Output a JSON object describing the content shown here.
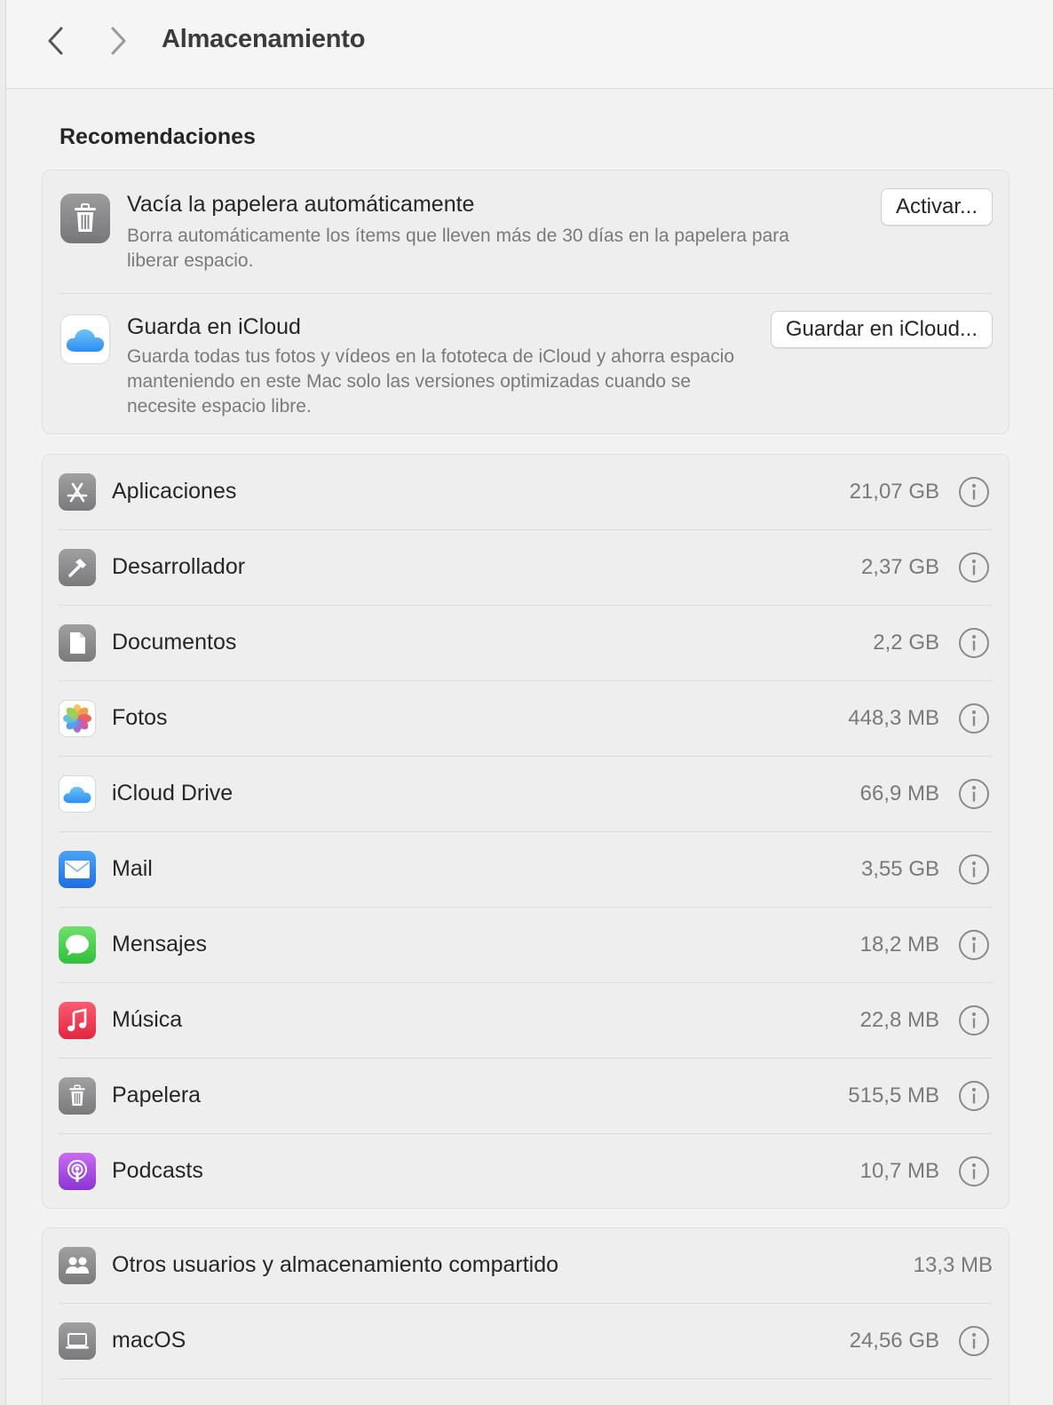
{
  "toolbar": {
    "back_icon": "chevron-left-icon",
    "forward_icon": "chevron-right-icon",
    "title": "Almacenamiento"
  },
  "recommendations": {
    "heading": "Recomendaciones",
    "items": [
      {
        "icon": "trash-icon",
        "title": "Vacía la papelera automáticamente",
        "description": "Borra automáticamente los ítems que lleven más de 30 días en la papelera para liberar espacio.",
        "button": "Activar..."
      },
      {
        "icon": "icloud-icon",
        "title": "Guarda en iCloud",
        "description": "Guarda todas tus fotos y vídeos en la fototeca de iCloud y ahorra espacio manteniendo en este Mac solo las versiones optimizadas cuando se necesite espacio libre.",
        "button": "Guardar en iCloud..."
      }
    ]
  },
  "categories": [
    {
      "label": "Aplicaciones",
      "size": "21,07 GB",
      "icon": "app-store-icon"
    },
    {
      "label": "Desarrollador",
      "size": "2,37 GB",
      "icon": "hammer-icon"
    },
    {
      "label": "Documentos",
      "size": "2,2 GB",
      "icon": "document-icon"
    },
    {
      "label": "Fotos",
      "size": "448,3 MB",
      "icon": "photos-icon"
    },
    {
      "label": "iCloud Drive",
      "size": "66,9 MB",
      "icon": "icloud-drive-icon"
    },
    {
      "label": "Mail",
      "size": "3,55 GB",
      "icon": "mail-icon"
    },
    {
      "label": "Mensajes",
      "size": "18,2 MB",
      "icon": "messages-icon"
    },
    {
      "label": "Música",
      "size": "22,8 MB",
      "icon": "music-icon"
    },
    {
      "label": "Papelera",
      "size": "515,5 MB",
      "icon": "trash-icon"
    },
    {
      "label": "Podcasts",
      "size": "10,7 MB",
      "icon": "podcasts-icon"
    }
  ],
  "system": [
    {
      "label": "Otros usuarios y almacenamiento compartido",
      "size": "13,3 MB",
      "icon": "users-icon"
    },
    {
      "label": "macOS",
      "size": "24,56 GB",
      "icon": "laptop-icon"
    }
  ],
  "colors": {
    "mail": "#1c6fe0",
    "messages": "#30c03a",
    "music": "#e0283e",
    "podcasts": "#8a35d4"
  }
}
